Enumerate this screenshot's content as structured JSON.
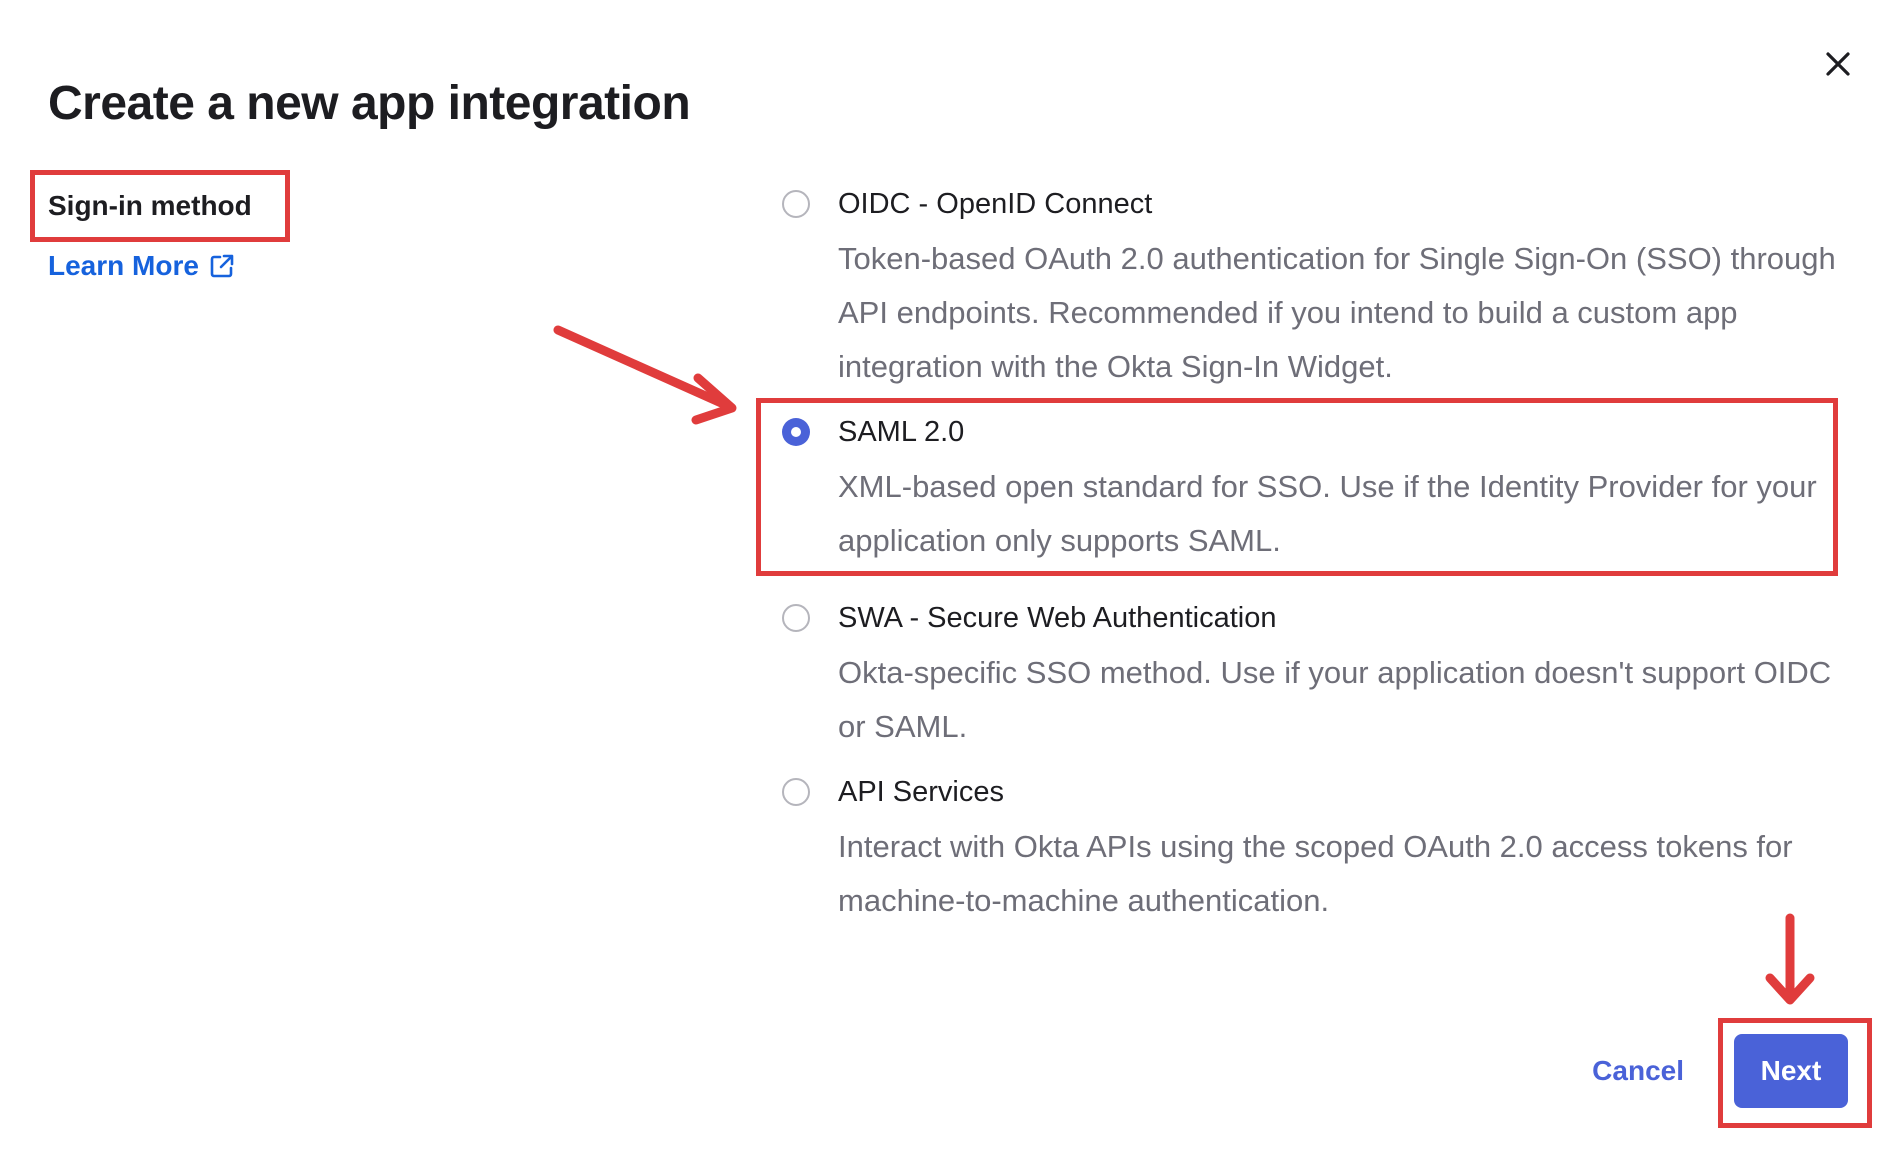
{
  "dialog": {
    "title": "Create a new app integration",
    "close_icon": "close-icon"
  },
  "left": {
    "section_heading": "Sign-in method",
    "learn_more_label": "Learn More",
    "learn_more_icon": "external-link-icon"
  },
  "options": [
    {
      "label": "OIDC - OpenID Connect",
      "description": "Token-based OAuth 2.0 authentication for Single Sign-On (SSO) through API endpoints. Recommended if you intend to build a custom app integration with the Okta Sign-In Widget.",
      "selected": false
    },
    {
      "label": "SAML 2.0",
      "description": "XML-based open standard for SSO. Use if the Identity Provider for your application only supports SAML.",
      "selected": true
    },
    {
      "label": "SWA - Secure Web Authentication",
      "description": "Okta-specific SSO method. Use if your application doesn't support OIDC or SAML.",
      "selected": false
    },
    {
      "label": "API Services",
      "description": "Interact with Okta APIs using the scoped OAuth 2.0 access tokens for machine-to-machine authentication.",
      "selected": false
    }
  ],
  "footer": {
    "cancel_label": "Cancel",
    "next_label": "Next"
  },
  "colors": {
    "accent": "#4a62d8",
    "link": "#1662dd",
    "annotation": "#e03c3c",
    "description_text": "#6e6e78"
  }
}
